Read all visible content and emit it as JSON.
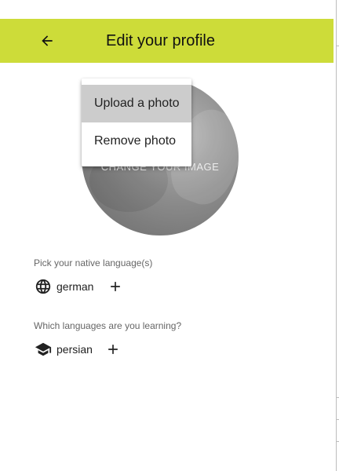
{
  "app_bar": {
    "title": "Edit your profile",
    "background": "#cddc39",
    "back_icon": "arrow-back-icon"
  },
  "avatar": {
    "label": "CHANGE YOUR IMAGE"
  },
  "photo_menu": {
    "items": [
      {
        "label": "Upload a photo",
        "highlighted": true
      },
      {
        "label": "Remove photo",
        "highlighted": false
      }
    ]
  },
  "native_languages": {
    "label": "Pick your native language(s)",
    "icon": "globe-icon",
    "items": [
      "german"
    ],
    "add_icon": "plus-icon"
  },
  "learning_languages": {
    "label": "Which languages are you learning?",
    "icon": "school-icon",
    "items": [
      "persian"
    ],
    "add_icon": "plus-icon"
  }
}
